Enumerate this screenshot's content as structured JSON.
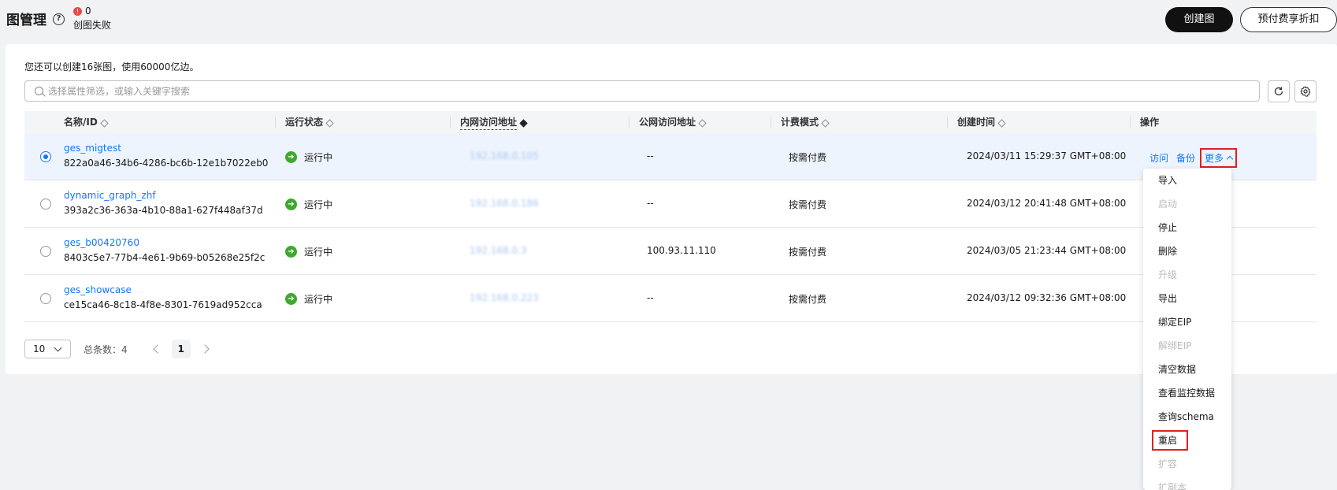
{
  "header": {
    "title": "图管理",
    "help": "?",
    "fail_count": "0",
    "fail_label": "创图失败",
    "create_button": "创建图",
    "prepaid_button": "预付费享折扣"
  },
  "toolbar": {
    "quota_text": "您还可以创建16张图，使用60000亿边。",
    "search_placeholder": "选择属性筛选，或输入关键字搜索"
  },
  "table": {
    "columns": [
      "名称/ID",
      "运行状态",
      "内网访问地址",
      "公网访问地址",
      "计费模式",
      "创建时间",
      "操作"
    ],
    "rows": [
      {
        "name": "ges_migtest",
        "id": "822a0a46-34b6-4286-bc6b-12e1b7022eb0",
        "status": "运行中",
        "private_ip": "192.168.0.105",
        "public_ip": "--",
        "billing": "按需付费",
        "created": "2024/03/11 15:29:37 GMT+08:00",
        "selected": true
      },
      {
        "name": "dynamic_graph_zhf",
        "id": "393a2c36-363a-4b10-88a1-627f448af37d",
        "status": "运行中",
        "private_ip": "192.168.0.186",
        "public_ip": "--",
        "billing": "按需付费",
        "created": "2024/03/12 20:41:48 GMT+08:00",
        "selected": false
      },
      {
        "name": "ges_b00420760",
        "id": "8403c5e7-77b4-4e61-9b69-b05268e25f2c",
        "status": "运行中",
        "private_ip": "192.168.0.3",
        "public_ip": "100.93.11.110",
        "billing": "按需付费",
        "created": "2024/03/05 21:23:44 GMT+08:00",
        "selected": false
      },
      {
        "name": "ges_showcase",
        "id": "ce15ca46-8c18-4f8e-8301-7619ad952cca",
        "status": "运行中",
        "private_ip": "192.168.0.223",
        "public_ip": "--",
        "billing": "按需付费",
        "created": "2024/03/12 09:32:36 GMT+08:00",
        "selected": false
      }
    ],
    "ops": {
      "visit": "访问",
      "backup": "备份",
      "more": "更多"
    }
  },
  "pager": {
    "page_size": "10",
    "total_label": "总条数：4",
    "current_page": "1"
  },
  "more_menu": [
    {
      "label": "导入",
      "disabled": false
    },
    {
      "label": "启动",
      "disabled": true
    },
    {
      "label": "停止",
      "disabled": false
    },
    {
      "label": "删除",
      "disabled": false
    },
    {
      "label": "升级",
      "disabled": true
    },
    {
      "label": "导出",
      "disabled": false
    },
    {
      "label": "绑定EIP",
      "disabled": false
    },
    {
      "label": "解绑EIP",
      "disabled": true
    },
    {
      "label": "清空数据",
      "disabled": false
    },
    {
      "label": "查看监控数据",
      "disabled": false
    },
    {
      "label": "查询schema",
      "disabled": false
    },
    {
      "label": "重启",
      "disabled": false
    },
    {
      "label": "扩容",
      "disabled": true
    },
    {
      "label": "扩副本",
      "disabled": true
    }
  ],
  "colors": {
    "link": "#1476ff",
    "running": "#3fa82f",
    "highlight_border": "#e02020"
  }
}
